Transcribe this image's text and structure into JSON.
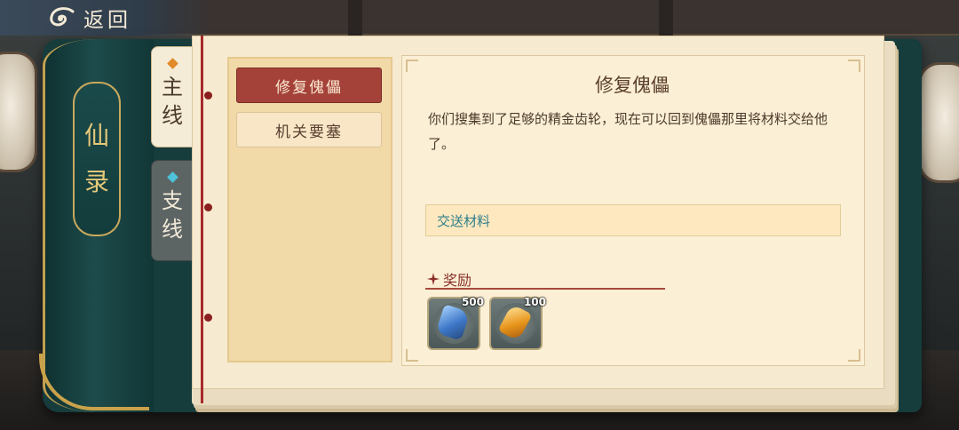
{
  "header": {
    "back_label": "返回"
  },
  "book": {
    "spine_title": [
      "仙",
      "录"
    ],
    "tabs": [
      {
        "label_lines": [
          "主",
          "线"
        ],
        "selected": true
      },
      {
        "label_lines": [
          "支",
          "线"
        ],
        "selected": false
      }
    ]
  },
  "quest_list": [
    {
      "label": "修复傀儡",
      "active": true
    },
    {
      "label": "机关要塞",
      "active": false
    }
  ],
  "quest_detail": {
    "title": "修复傀儡",
    "description": "你们搜集到了足够的精金齿轮，现在可以回到傀儡那里将材料交给他了。",
    "objective": "交送材料",
    "reward_heading": "奖励",
    "rewards": [
      {
        "icon": "blue-ore-icon",
        "count": "500"
      },
      {
        "icon": "amber-crystal-icon",
        "count": "100"
      }
    ]
  },
  "colors": {
    "accent_red": "#a4423a",
    "objective_text": "#2f7f8a",
    "book_cover": "#163c3c",
    "page": "#f6ead0"
  }
}
